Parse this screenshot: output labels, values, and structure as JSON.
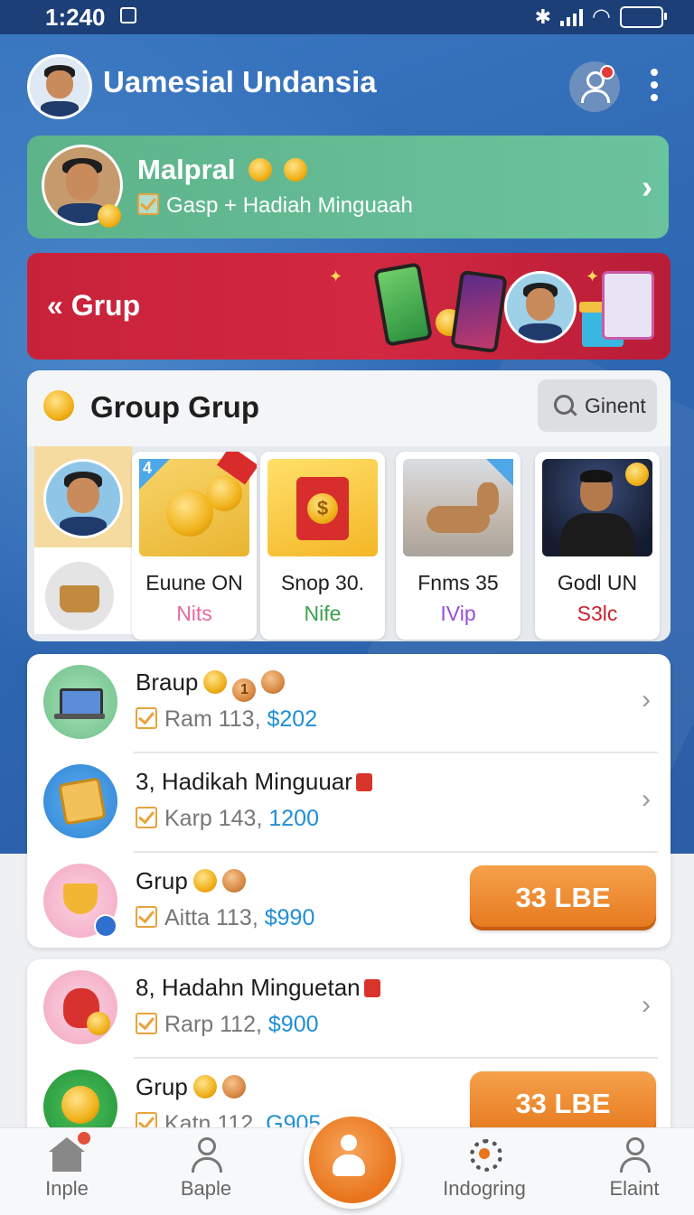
{
  "status_bar": {
    "time": "1:240"
  },
  "header": {
    "title": "Uamesial Undansia"
  },
  "profile_card": {
    "title": "Malpral",
    "subtitle": "Gasp + Hadiah Minguaah"
  },
  "banner": {
    "label": "Grup"
  },
  "group_panel": {
    "title": "Group Grup",
    "search_label": "Ginent",
    "tiles": [
      {
        "name": "Euune ON",
        "tag": "Nits",
        "tag_color": "#e56aa0",
        "badge": "4"
      },
      {
        "name": "Snop 30.",
        "tag": "Nife",
        "tag_color": "#3aa04a"
      },
      {
        "name": "Fnms 35",
        "tag": "IVip",
        "tag_color": "#9a4fd0"
      },
      {
        "name": "Godl UN",
        "tag": "S3lc",
        "tag_color": "#c9232e"
      }
    ]
  },
  "list": {
    "items": [
      {
        "title": "Braup",
        "sub_prefix": "Ram 113,",
        "amount": "$202",
        "action": "arrow",
        "coin_num": "1"
      },
      {
        "title": "3, Hadikah Minguuar",
        "sub_prefix": "Karp 143,",
        "amount": "1200",
        "action": "arrow"
      },
      {
        "title": "Grup",
        "sub_prefix": "Aitta 113,",
        "amount": "$990",
        "action": "button",
        "button_label": "33 LBE"
      },
      {
        "title": "8, Hadahn Minguetan",
        "sub_prefix": "Rarp 112,",
        "amount": "$900",
        "action": "arrow"
      },
      {
        "title": "Grup",
        "sub_prefix": "Katn 112,",
        "amount": "G905",
        "action": "button",
        "button_label": "33 LBE"
      }
    ]
  },
  "bottom_nav": {
    "items": [
      {
        "label": "Inple",
        "icon": "home-icon"
      },
      {
        "label": "Baple",
        "icon": "user-icon"
      },
      {
        "label": "Indogring",
        "icon": "gear-icon"
      },
      {
        "label": "Elaint",
        "icon": "person-icon"
      }
    ]
  },
  "colors": {
    "header_blue": "#2f68b3",
    "green_card": "#5db38a",
    "red_banner": "#c8223a",
    "accent_orange": "#e8781e",
    "amount_blue": "#1f8fd6"
  }
}
